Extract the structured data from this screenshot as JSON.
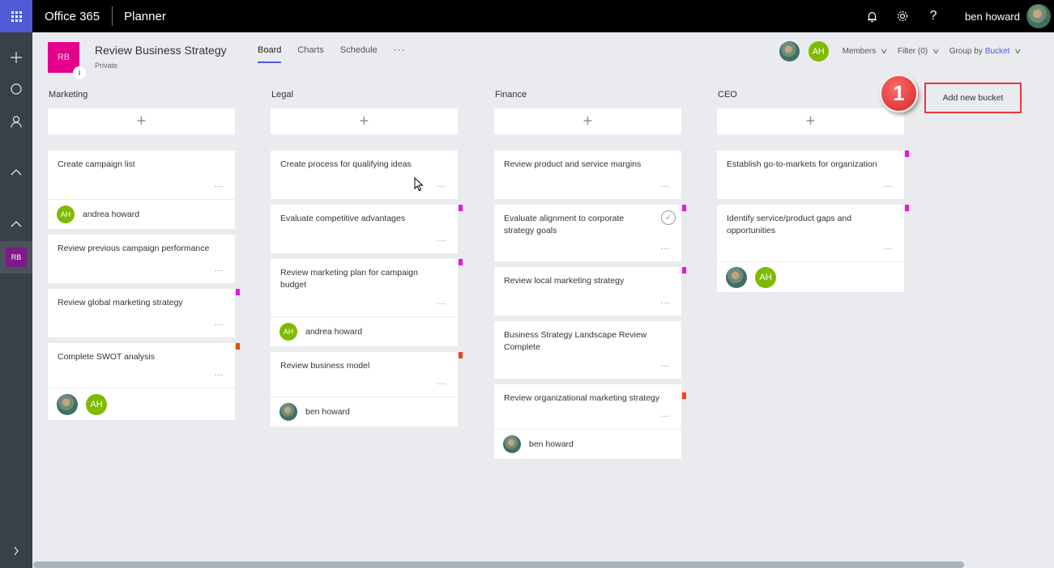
{
  "topbar": {
    "suite": "Office 365",
    "app": "Planner",
    "icons": [
      "bell-icon",
      "gear-icon",
      "help-icon"
    ],
    "icon_glyphs": {
      "bell": "🔔︎",
      "gear": "⚙",
      "help": "?"
    },
    "user_name": "ben howard"
  },
  "rail": {
    "icons": [
      "plus-icon",
      "circle-icon",
      "person-icon",
      "chevron-up-icon",
      "chevron-up-icon",
      "chevron-right-icon"
    ],
    "glyphs": {
      "plus": "+",
      "circle": "○",
      "person": "⚇",
      "up": "^",
      "right": "›"
    },
    "active_plan_initials": "RB"
  },
  "plan": {
    "initials": "RB",
    "info_glyph": "i",
    "title": "Review Business Strategy",
    "privacy": "Private",
    "color": "#e3008c"
  },
  "tabs": [
    {
      "label": "Board",
      "active": true
    },
    {
      "label": "Charts",
      "active": false
    },
    {
      "label": "Schedule",
      "active": false
    }
  ],
  "tabs_more": "···",
  "header_right": {
    "member_initials": "AH",
    "members_label": "Members",
    "filter_label": "Filter (0)",
    "group_label": "Group by",
    "group_value": "Bucket",
    "chevron": "∨"
  },
  "add_glyph": "+",
  "card_more": "···",
  "buckets": [
    {
      "name": "Marketing",
      "cards": [
        {
          "title": "Create campaign list",
          "assignee": "andrea howard",
          "assignee_initials": "AH"
        },
        {
          "title": "Review previous campaign performance"
        },
        {
          "title": "Review global marketing strategy",
          "label_color": "#e815e8"
        },
        {
          "title": "Complete SWOT analysis",
          "label_color": "#e8490f",
          "assignees": [
            "ben howard",
            "AH"
          ]
        }
      ]
    },
    {
      "name": "Legal",
      "cards": [
        {
          "title": "Create process for qualifying ideas"
        },
        {
          "title": "Evaluate competitive advantages",
          "label_color": "#e815e8"
        },
        {
          "title": "Review marketing plan for campaign budget",
          "label_color": "#e815e8",
          "assignee": "andrea howard",
          "assignee_initials": "AH"
        },
        {
          "title": "Review business model",
          "label_color": "#e8490f",
          "assignee": "ben howard"
        }
      ]
    },
    {
      "name": "Finance",
      "cards": [
        {
          "title": "Review product and service margins"
        },
        {
          "title": "Evaluate alignment to corporate strategy goals",
          "label_color": "#e815e8",
          "check_glyph": "✓"
        },
        {
          "title": "Review local marketing strategy",
          "label_color": "#e815e8"
        },
        {
          "title": "Business Strategy Landscape Review Complete"
        },
        {
          "title": "Review organizational marketing strategy",
          "label_color": "#e8490f",
          "assignee": "ben howard"
        }
      ]
    },
    {
      "name": "CEO",
      "cards": [
        {
          "title": "Establish go-to-markets for organization",
          "label_color": "#e815e8"
        },
        {
          "title": "Identify service/product gaps and opportunities",
          "label_color": "#e815e8",
          "assignees": [
            "ben howard",
            "AH"
          ]
        }
      ]
    }
  ],
  "add_bucket_label": "Add new bucket",
  "step_badge": "1",
  "colors": {
    "accent": "#4f5bd5",
    "member_green": "#7fba00",
    "label_pink": "#e815e8",
    "label_orange": "#e8490f",
    "highlight_red": "#e8393c"
  }
}
